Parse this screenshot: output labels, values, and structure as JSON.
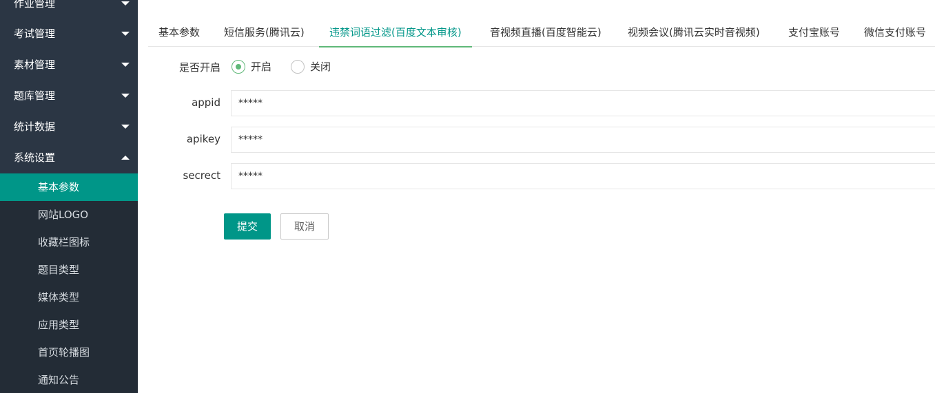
{
  "sidebar": {
    "groups": [
      {
        "label": "作业管理",
        "expanded": false
      },
      {
        "label": "考试管理",
        "expanded": false
      },
      {
        "label": "素材管理",
        "expanded": false
      },
      {
        "label": "题库管理",
        "expanded": false
      },
      {
        "label": "统计数据",
        "expanded": false
      },
      {
        "label": "系统设置",
        "expanded": true
      }
    ],
    "sub_items": [
      {
        "label": "基本参数",
        "active": true
      },
      {
        "label": "网站LOGO",
        "active": false
      },
      {
        "label": "收藏栏图标",
        "active": false
      },
      {
        "label": "题目类型",
        "active": false
      },
      {
        "label": "媒体类型",
        "active": false
      },
      {
        "label": "应用类型",
        "active": false
      },
      {
        "label": "首页轮播图",
        "active": false
      },
      {
        "label": "通知公告",
        "active": false
      }
    ]
  },
  "tabs": [
    {
      "label": "基本参数"
    },
    {
      "label": "短信服务(腾讯云)"
    },
    {
      "label": "违禁词语过滤(百度文本审核)",
      "active": true
    },
    {
      "label": "音视频直播(百度智能云)"
    },
    {
      "label": "视频会议(腾讯云实时音视频)"
    },
    {
      "label": "支付宝账号"
    },
    {
      "label": "微信支付账号"
    }
  ],
  "form": {
    "enable_label": "是否开启",
    "enable_on": "开启",
    "enable_off": "关闭",
    "enabled": true,
    "appid_label": "appid",
    "appid_value": "*****",
    "apikey_label": "apikey",
    "apikey_value": "*****",
    "secret_label": "secrect",
    "secret_value": "*****",
    "submit_label": "提交",
    "cancel_label": "取消"
  },
  "colors": {
    "accent": "#009688",
    "radio_checked": "#5fb878",
    "sidebar_bg": "#2b3644",
    "submenu_bg": "#232c36"
  }
}
